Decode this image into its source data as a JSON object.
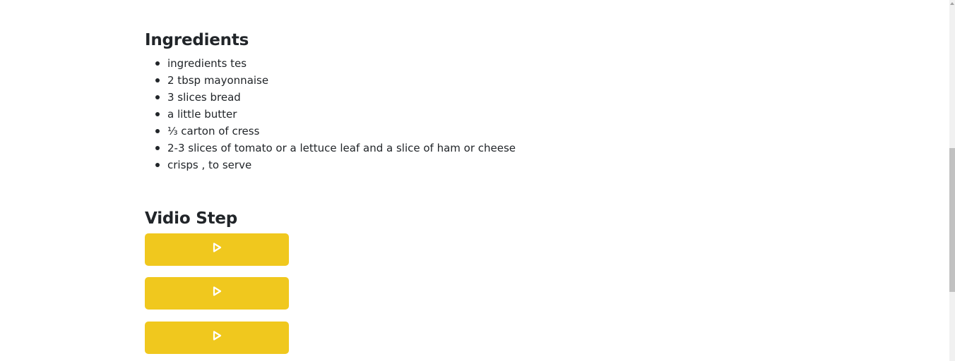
{
  "ingredients": {
    "heading": "Ingredients",
    "items": [
      "ingredients tes",
      "2 tbsp mayonnaise",
      "3 slices bread",
      "a little butter",
      "⅓ carton of cress",
      "2-3 slices of tomato or a lettuce leaf and a slice of ham or cheese",
      "crisps , to serve"
    ]
  },
  "video_steps": {
    "heading": "Vidio Step",
    "buttons": [
      {
        "icon": "play-icon"
      },
      {
        "icon": "play-icon"
      },
      {
        "icon": "play-icon"
      }
    ],
    "button_color": "#f0c81e",
    "icon_color": "#ffffff"
  },
  "colors": {
    "text": "#212529",
    "background": "#ffffff"
  }
}
